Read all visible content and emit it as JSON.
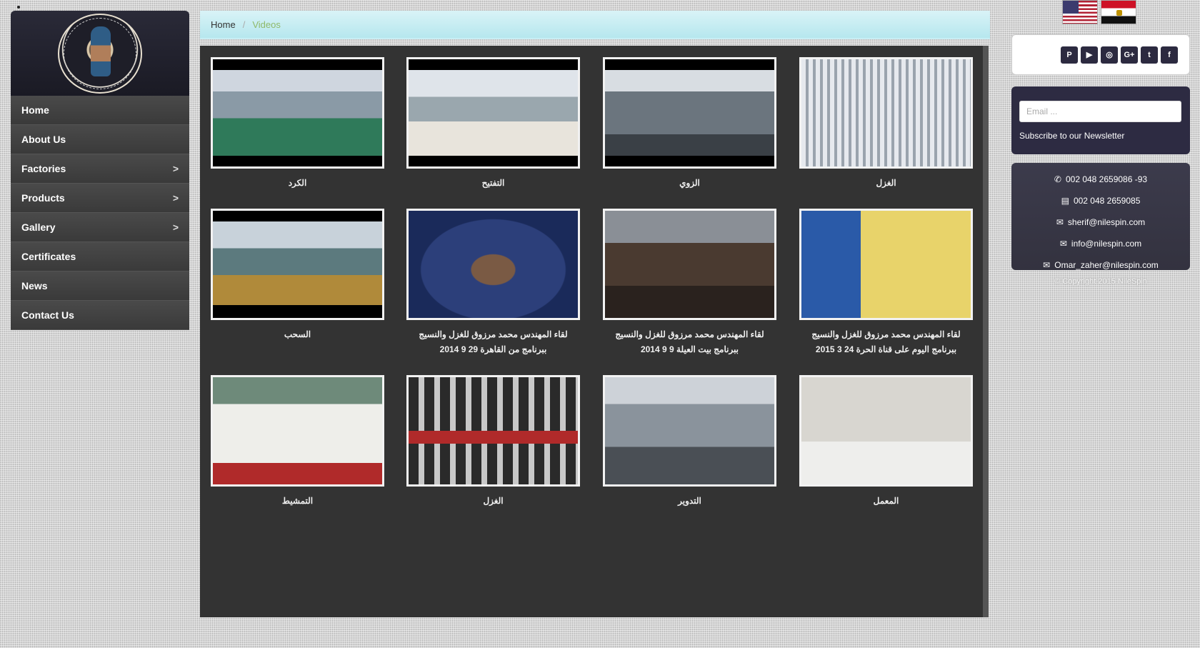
{
  "sidebar": {
    "logo_alt": "The Nile Spinning & Weaving Co.",
    "items": [
      {
        "label": "Home",
        "chevron": ""
      },
      {
        "label": "About Us",
        "chevron": ""
      },
      {
        "label": "Factories",
        "chevron": ">"
      },
      {
        "label": "Products",
        "chevron": ">"
      },
      {
        "label": "Gallery",
        "chevron": ">"
      },
      {
        "label": "Certificates",
        "chevron": ""
      },
      {
        "label": "News",
        "chevron": ""
      },
      {
        "label": "Contact Us",
        "chevron": ""
      }
    ]
  },
  "breadcrumb": {
    "home": "Home",
    "separator": "/",
    "current": "Videos"
  },
  "videos": [
    {
      "caption": "الكرد"
    },
    {
      "caption": "التفتيح"
    },
    {
      "caption": "الزوي"
    },
    {
      "caption": "الغزل"
    },
    {
      "caption": "السحب"
    },
    {
      "caption": "لقاء المهندس محمد مرزوق للغزل والنسيج ببرنامج من القاهرة 29 9 2014"
    },
    {
      "caption": "لقاء المهندس محمد مرزوق للغزل والنسيج ببرنامج بيت العيلة 9 9 2014"
    },
    {
      "caption": "لقاء المهندس محمد مرزوق للغزل والنسيج ببرنامج اليوم على قناة الحرة 24 3 2015"
    },
    {
      "caption": "التمشيط"
    },
    {
      "caption": "الغزل"
    },
    {
      "caption": "التدوير"
    },
    {
      "caption": "المعمل"
    }
  ],
  "social": [
    "P",
    "▶",
    "◎",
    "G+",
    "t",
    "f"
  ],
  "newsletter": {
    "placeholder": "Email ...",
    "label": "Subscribe to our Newsletter"
  },
  "contact": {
    "phone": "002 048 2659086 -93",
    "fax": "002 048 2659085",
    "email1": "sherif@nilespin.com",
    "email2": "info@nilespin.com",
    "email3": "Omar_zaher@nilespin.com"
  },
  "copyright": "© Copyright 2015 NileSpin"
}
